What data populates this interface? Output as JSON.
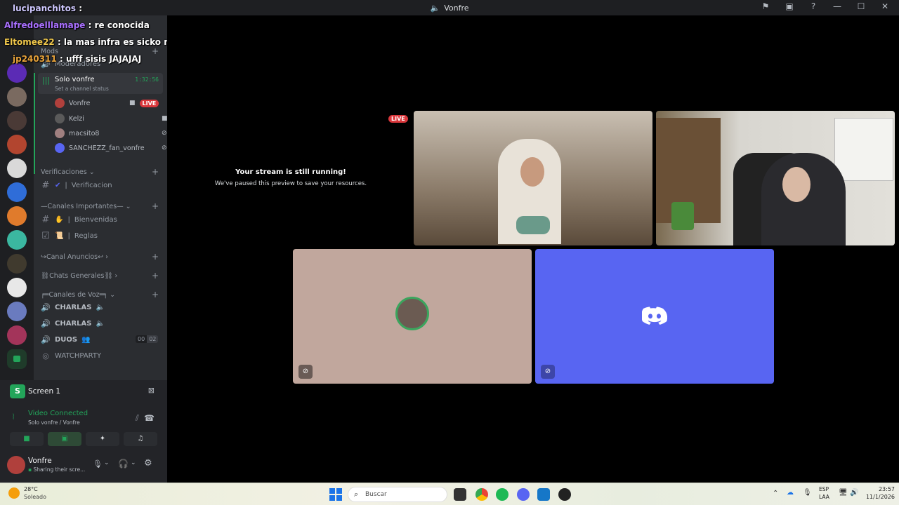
{
  "window": {
    "title": "Vonfre"
  },
  "chat_overlay": [
    {
      "user": "lucipanchitos",
      "text": " :"
    },
    {
      "user": "Alfredoelllamape",
      "text": " : re conocida"
    },
    {
      "user": "Eltomee22",
      "text": " : la mas infra es sicko mode"
    },
    {
      "user": "jp240311",
      "text": " : ufff sisis JAJAJAJ"
    }
  ],
  "sidebar": {
    "mods_label": "Mods",
    "moderadores_label": "Moderadores",
    "voice_channel": {
      "name": "Solo vonfre",
      "timer": "1:32:56",
      "status": "Set a channel status"
    },
    "voice_users": [
      {
        "name": "Vonfre",
        "live": "LIVE"
      },
      {
        "name": "Kelzi"
      },
      {
        "name": "macsito8"
      },
      {
        "name": "SANCHEZZ_fan_vonfre"
      }
    ],
    "categories": [
      {
        "label": "Verificaciones"
      },
      {
        "label": "Canales Importantes"
      },
      {
        "label": "Canal Anuncios"
      },
      {
        "label": "Chats Generales"
      },
      {
        "label": "Canales de Voz"
      }
    ],
    "channels": {
      "verificacion": "Verificacion",
      "bienvenidas": "Bienvenidas",
      "reglas": "Reglas",
      "charlas1": "CHARLAS",
      "charlas2": "CHARLAS",
      "duos": "DUOS",
      "duos_count_a": "00",
      "duos_count_b": "02",
      "watchparty": "WATCHPARTY"
    }
  },
  "stream_panel": {
    "title": "Screen 1"
  },
  "voice_panel": {
    "status": "Video Connected",
    "location": "Solo vonfre / Vonfre"
  },
  "user_panel": {
    "name": "Vonfre",
    "status": "Sharing their scre..."
  },
  "main": {
    "paused_title": "Your stream is still running!",
    "paused_sub": "We've paused this preview to save your resources.",
    "live_badge": "LIVE"
  },
  "taskbar": {
    "weather_temp": "28°C",
    "weather_desc": "Soleado",
    "search_placeholder": "Buscar",
    "lang_top": "ESP",
    "lang_bottom": "LAA",
    "time": "23:57",
    "date": "11/1/2026"
  },
  "colors": {
    "blurple": "#5865f2",
    "green": "#23a55a",
    "red": "#da373c",
    "bg": "#2b2d31"
  }
}
